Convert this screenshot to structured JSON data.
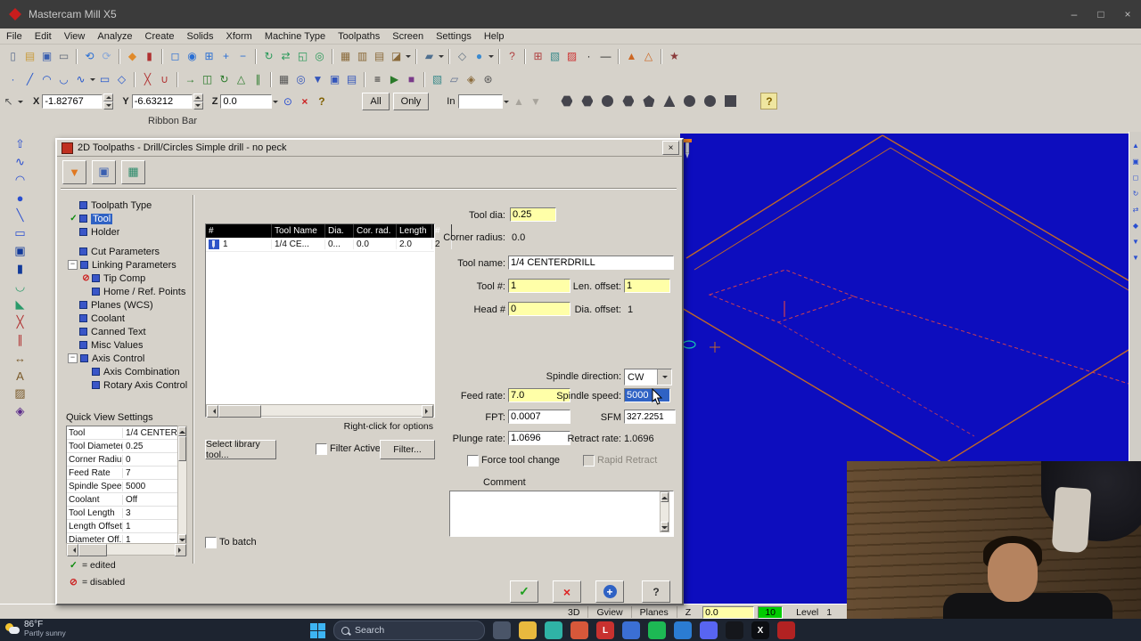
{
  "titlebar": {
    "title": "Mastercam Mill X5",
    "min": "–",
    "max": "□",
    "close": "×"
  },
  "menubar": [
    {
      "label": "File",
      "name": "menu-file"
    },
    {
      "label": "Edit",
      "name": "menu-edit"
    },
    {
      "label": "View",
      "name": "menu-view"
    },
    {
      "label": "Analyze",
      "name": "menu-analyze"
    },
    {
      "label": "Create",
      "name": "menu-create"
    },
    {
      "label": "Solids",
      "name": "menu-solids"
    },
    {
      "label": "Xform",
      "name": "menu-xform"
    },
    {
      "label": "Machine Type",
      "name": "menu-machine-type"
    },
    {
      "label": "Toolpaths",
      "name": "menu-toolpaths"
    },
    {
      "label": "Screen",
      "name": "menu-screen"
    },
    {
      "label": "Settings",
      "name": "menu-settings"
    },
    {
      "label": "Help",
      "name": "menu-help"
    }
  ],
  "toolbar1": [
    {
      "name": "new-file-icon",
      "g": "▯",
      "c": "#607090"
    },
    {
      "name": "open-folder-icon",
      "g": "▤",
      "c": "#c89a3a"
    },
    {
      "name": "save-icon",
      "g": "▣",
      "c": "#3a5fb0"
    },
    {
      "name": "print-icon",
      "g": "▭",
      "c": "#606878"
    },
    {
      "name": "toolbar-separator",
      "cls": "sepv"
    },
    {
      "name": "undo-icon",
      "g": "⟲",
      "c": "#2a6fd4"
    },
    {
      "name": "redo-icon",
      "g": "⟳",
      "c": "#8aa8d8"
    },
    {
      "name": "toolbar-separator",
      "cls": "sepv"
    },
    {
      "name": "xform-dynamic-icon",
      "g": "◆",
      "c": "#e08a2a"
    },
    {
      "name": "delete-entities-icon",
      "g": "▮",
      "c": "#b03030"
    },
    {
      "name": "toolbar-separator",
      "cls": "sepv"
    },
    {
      "name": "zoom-window-icon",
      "g": "◻",
      "c": "#2a6fd4"
    },
    {
      "name": "zoom-target-icon",
      "g": "◉",
      "c": "#2a6fd4"
    },
    {
      "name": "zoom-selected-icon",
      "g": "⊞",
      "c": "#2a6fd4"
    },
    {
      "name": "zoom-in-icon",
      "g": "+",
      "c": "#2a6fd4"
    },
    {
      "name": "zoom-out-icon",
      "g": "−",
      "c": "#2a6fd4"
    },
    {
      "name": "toolbar-separator",
      "cls": "sepv"
    },
    {
      "name": "dynamic-rotate-icon",
      "g": "↻",
      "c": "#2a9a5a"
    },
    {
      "name": "pan-icon",
      "g": "⇄",
      "c": "#2a9a5a"
    },
    {
      "name": "fit-screen-icon",
      "g": "◱",
      "c": "#2a9a5a"
    },
    {
      "name": "repaint-icon",
      "g": "◎",
      "c": "#2a9a5a"
    },
    {
      "name": "toolbar-separator",
      "cls": "sepv"
    },
    {
      "name": "gview-top-icon",
      "g": "▦",
      "c": "#8a6a3a"
    },
    {
      "name": "gview-front-icon",
      "g": "▥",
      "c": "#8a6a3a"
    },
    {
      "name": "gview-side-icon",
      "g": "▤",
      "c": "#8a6a3a"
    },
    {
      "name": "gview-isometric-icon",
      "g": "◪",
      "c": "#8a6a3a"
    },
    {
      "name": "dropdown-caret-icon",
      "cls": "caret"
    },
    {
      "name": "toolbar-separator",
      "cls": "sepv"
    },
    {
      "name": "planes-icon",
      "g": "▰",
      "c": "#507090"
    },
    {
      "name": "dropdown-caret-icon",
      "cls": "caret"
    },
    {
      "name": "toolbar-separator",
      "cls": "sepv"
    },
    {
      "name": "wireframe-display-icon",
      "g": "◇",
      "c": "#607080"
    },
    {
      "name": "shaded-display-icon",
      "g": "●",
      "c": "#3a8ad0"
    },
    {
      "name": "dropdown-caret-icon",
      "cls": "caret"
    },
    {
      "name": "toolbar-separator",
      "cls": "sepv"
    },
    {
      "name": "analyze-entity-icon",
      "g": "?",
      "c": "#b04040"
    },
    {
      "name": "toolbar-separator",
      "cls": "sepv"
    },
    {
      "name": "grid-settings-icon",
      "g": "⊞",
      "c": "#b04040"
    },
    {
      "name": "attributes-icon",
      "g": "▧",
      "c": "#3a8a8a"
    },
    {
      "name": "color-swatch-icon",
      "g": "▨",
      "c": "#cc3333"
    },
    {
      "name": "point-style-icon",
      "g": "·",
      "c": "#202020"
    },
    {
      "name": "line-style-icon",
      "g": "—",
      "c": "#202020"
    },
    {
      "name": "toolbar-separator",
      "cls": "sepv"
    },
    {
      "name": "wcs-icon",
      "g": "▲",
      "c": "#cc6622"
    },
    {
      "name": "gview-wcs-icon",
      "g": "△",
      "c": "#cc6622"
    },
    {
      "name": "toolbar-separator",
      "cls": "sepv"
    },
    {
      "name": "run-addin-icon",
      "g": "★",
      "c": "#8a3a3a"
    }
  ],
  "toolbar2": [
    {
      "name": "create-point-icon",
      "g": "·",
      "c": "#2255cc"
    },
    {
      "name": "create-line-icon",
      "g": "╱",
      "c": "#2255cc"
    },
    {
      "name": "create-arc-icon",
      "g": "◠",
      "c": "#2255cc"
    },
    {
      "name": "create-fillet-icon",
      "g": "◡",
      "c": "#2255cc"
    },
    {
      "name": "create-spline-icon",
      "g": "∿",
      "c": "#2255cc"
    },
    {
      "name": "dropdown-caret-icon",
      "cls": "caret"
    },
    {
      "name": "create-rectangle-icon",
      "g": "▭",
      "c": "#2255cc"
    },
    {
      "name": "create-polygon-icon",
      "g": "◇",
      "c": "#2255cc"
    },
    {
      "name": "toolbar-separator",
      "cls": "sepv"
    },
    {
      "name": "trim-break-icon",
      "g": "╳",
      "c": "#b03030"
    },
    {
      "name": "join-entities-icon",
      "g": "∪",
      "c": "#b03030"
    },
    {
      "name": "toolbar-separator",
      "cls": "sepv"
    },
    {
      "name": "xform-translate-icon",
      "g": "→",
      "c": "#2a7a2a"
    },
    {
      "name": "xform-mirror-icon",
      "g": "◫",
      "c": "#2a7a2a"
    },
    {
      "name": "xform-rotate-icon",
      "g": "↻",
      "c": "#2a7a2a"
    },
    {
      "name": "xform-scale-icon",
      "g": "△",
      "c": "#2a7a2a"
    },
    {
      "name": "xform-offset-icon",
      "g": "∥",
      "c": "#2a7a2a"
    },
    {
      "name": "toolbar-separator",
      "cls": "sepv"
    },
    {
      "name": "machine-group-icon",
      "g": "▦",
      "c": "#555555"
    },
    {
      "name": "toolpath-contour-icon",
      "g": "◎",
      "c": "#3355bb"
    },
    {
      "name": "toolpath-drill-icon",
      "g": "▼",
      "c": "#3355bb"
    },
    {
      "name": "toolpath-pocket-icon",
      "g": "▣",
      "c": "#3355bb"
    },
    {
      "name": "toolpath-face-icon",
      "g": "▤",
      "c": "#3355bb"
    },
    {
      "name": "toolbar-separator",
      "cls": "sepv"
    },
    {
      "name": "operations-manager-icon",
      "g": "≡",
      "c": "#202020"
    },
    {
      "name": "backplot-icon",
      "g": "▶",
      "c": "#2a7a2a"
    },
    {
      "name": "verify-icon",
      "g": "■",
      "c": "#7a3a8a"
    },
    {
      "name": "toolbar-separator",
      "cls": "sepv"
    },
    {
      "name": "levels-icon",
      "g": "▧",
      "c": "#3a8a8a"
    },
    {
      "name": "viewsheets-icon",
      "g": "▱",
      "c": "#607090"
    },
    {
      "name": "groups-icon",
      "g": "◈",
      "c": "#8a6a3a"
    },
    {
      "name": "settings-gear-icon",
      "g": "⊛",
      "c": "#555555"
    }
  ],
  "ribbon": {
    "x_label": "X",
    "x_value": "-1.82767",
    "y_label": "Y",
    "y_value": "-6.63212",
    "z_label": "Z",
    "z_value": "0.0",
    "all": "All",
    "only": "Only",
    "in_label": "In",
    "in_value": "",
    "help": "?",
    "shapes": [
      {
        "name": "autocursor-origin-icon",
        "cls": "hex"
      },
      {
        "name": "autocursor-arc-center-icon",
        "cls": "hex"
      },
      {
        "name": "autocursor-endpoint-icon",
        "cls": "cir"
      },
      {
        "name": "autocursor-intersection-icon",
        "cls": "hex"
      },
      {
        "name": "autocursor-midpoint-icon",
        "cls": "pent"
      },
      {
        "name": "autocursor-point-icon",
        "cls": "tri"
      },
      {
        "name": "autocursor-quadrant-icon",
        "cls": "cir"
      },
      {
        "name": "autocursor-along-icon",
        "cls": "cir"
      },
      {
        "name": "autocursor-nearest-icon",
        "cls": ""
      }
    ]
  },
  "ribbon_strip": {
    "label": "Ribbon Bar"
  },
  "left_toolbar": [
    {
      "name": "select-arrow-icon",
      "g": "⇧",
      "c": "#2a4fd0"
    },
    {
      "name": "spline-tool-icon",
      "g": "∿",
      "c": "#2a4fd0"
    },
    {
      "name": "arc-tool-icon",
      "g": "◠",
      "c": "#2a4fd0"
    },
    {
      "name": "circle-tool-icon",
      "g": "●",
      "c": "#2a4fd0"
    },
    {
      "name": "line-tool-icon",
      "g": "╲",
      "c": "#2a4fd0"
    },
    {
      "name": "rect-tool-icon",
      "g": "▭",
      "c": "#2a4fd0"
    },
    {
      "name": "solid-box-icon",
      "g": "▣",
      "c": "#123a9a"
    },
    {
      "name": "solid-cylinder-icon",
      "g": "▮",
      "c": "#123a9a"
    },
    {
      "name": "fillet-tool-icon",
      "g": "◡",
      "c": "#2a9a6a"
    },
    {
      "name": "chamfer-tool-icon",
      "g": "◣",
      "c": "#2a9a6a"
    },
    {
      "name": "trim-tool-icon",
      "g": "╳",
      "c": "#b03030"
    },
    {
      "name": "offset-tool-icon",
      "g": "∥",
      "c": "#b03030"
    },
    {
      "name": "dimension-tool-icon",
      "g": "↔",
      "c": "#7a5a2a"
    },
    {
      "name": "note-tool-icon",
      "g": "A",
      "c": "#7a5a2a"
    },
    {
      "name": "hatch-tool-icon",
      "g": "▨",
      "c": "#7a5a2a"
    },
    {
      "name": "xform-tool-icon",
      "g": "◈",
      "c": "#5a2a8a"
    }
  ],
  "right_toolbar": [
    {
      "name": "scroll-up-icon",
      "g": "▲"
    },
    {
      "name": "fit-view-shortcut-icon",
      "g": "▣"
    },
    {
      "name": "zoom-shortcut-icon",
      "g": "◻"
    },
    {
      "name": "rotate-shortcut-icon",
      "g": "↻"
    },
    {
      "name": "pan-shortcut-icon",
      "g": "⇄"
    },
    {
      "name": "view-shortcut-icon",
      "g": "◆"
    },
    {
      "name": "scroll-down-icon",
      "g": "▼"
    },
    {
      "name": "scroll-down2-icon",
      "g": "▼"
    }
  ],
  "dialog": {
    "title": "2D Toolpaths - Drill/Circles Simple drill - no peck",
    "close": "×",
    "toolbar_icons": [
      {
        "name": "tool-manager-icon",
        "g": "▼",
        "c": "#e07820"
      },
      {
        "name": "save-parameters-icon",
        "g": "▣",
        "c": "#3a5fb0"
      },
      {
        "name": "tool-display-icon",
        "g": "▦",
        "c": "#2a8a6a"
      }
    ],
    "tree": [
      {
        "label": "Toolpath Type",
        "name": "tree-item-toolpath-type"
      },
      {
        "label": "Tool",
        "mark": "✓",
        "cls": "sel mk-green",
        "name": "tree-item-tool"
      },
      {
        "label": "Holder",
        "name": "tree-item-holder"
      },
      {
        "label": "Cut Parameters",
        "cls": "gaptop",
        "name": "tree-item-cut-parameters"
      },
      {
        "label": "Linking Parameters",
        "mark": "−",
        "cls": "mk-exp",
        "name": "tree-item-linking-parameters"
      },
      {
        "label": "Tip Comp",
        "mark": "⊘",
        "cls": "lvl1 mk-red",
        "name": "tree-item-tip-comp"
      },
      {
        "label": "Home / Ref. Points",
        "cls": "lvl1",
        "name": "tree-item-home-ref-points"
      },
      {
        "label": "Planes (WCS)",
        "name": "tree-item-planes-wcs"
      },
      {
        "label": "Coolant",
        "name": "tree-item-coolant"
      },
      {
        "label": "Canned Text",
        "name": "tree-item-canned-text"
      },
      {
        "label": "Misc Values",
        "name": "tree-item-misc-values"
      },
      {
        "label": "Axis Control",
        "mark": "−",
        "cls": "mk-exp",
        "name": "tree-item-axis-control"
      },
      {
        "label": "Axis Combination",
        "cls": "lvl1",
        "name": "tree-item-axis-combination"
      },
      {
        "label": "Rotary Axis Control",
        "cls": "lvl1",
        "name": "tree-item-rotary-axis-control"
      }
    ],
    "quick_view": {
      "title": "Quick View Settings",
      "rows": [
        {
          "k": "Tool",
          "v": "1/4 CENTER.",
          "name": "qv-row-tool"
        },
        {
          "k": "Tool Diameter",
          "v": "0.25",
          "name": "qv-row-tool-diameter"
        },
        {
          "k": "Corner Radius",
          "v": "0",
          "name": "qv-row-corner-radius"
        },
        {
          "k": "Feed Rate",
          "v": "7",
          "name": "qv-row-feed-rate"
        },
        {
          "k": "Spindle Speed",
          "v": "5000",
          "name": "qv-row-spindle-speed"
        },
        {
          "k": "Coolant",
          "v": "Off",
          "name": "qv-row-coolant"
        },
        {
          "k": "Tool Length",
          "v": "3",
          "name": "qv-row-tool-length"
        },
        {
          "k": "Length Offset",
          "v": "1",
          "name": "qv-row-length-offset"
        },
        {
          "k": "Diameter Off...",
          "v": "1",
          "name": "qv-row-diameter-offset"
        }
      ]
    },
    "legend": {
      "edited_mark": "✓",
      "edited": "= edited",
      "disabled_mark": "⊘",
      "disabled": "= disabled"
    },
    "grid": {
      "headers": [
        {
          "label": "#",
          "cls": "c1",
          "name": "grid-col-number"
        },
        {
          "label": "Tool Name",
          "cls": "c2",
          "name": "grid-col-tool-name"
        },
        {
          "label": "Dia.",
          "cls": "c3",
          "name": "grid-col-dia"
        },
        {
          "label": "Cor. rad.",
          "cls": "c4",
          "name": "grid-col-cor-rad"
        },
        {
          "label": "Length",
          "cls": "c5",
          "name": "grid-col-length"
        },
        {
          "label": "#",
          "cls": "c6",
          "name": "grid-col-flutes"
        }
      ],
      "row": {
        "num": "1",
        "name": "1/4 CE...",
        "dia": "0...",
        "cor": "0.0",
        "len": "2.0",
        "fl": "2"
      },
      "hint": "Right-click for options"
    },
    "buttons": {
      "select_library": "Select library tool...",
      "filter_active": "Filter Active",
      "filter": "Filter...",
      "force_tool_change": "Force tool change",
      "rapid_retract": "Rapid Retract",
      "to_batch": "To batch",
      "ok_glyph": "✓",
      "cancel_glyph": "×",
      "add_glyph": "+",
      "help_glyph": "?"
    },
    "fields": {
      "tool_dia_label": "Tool dia:",
      "tool_dia": "0.25",
      "corner_radius_label": "Corner radius:",
      "corner_radius": "0.0",
      "tool_name_label": "Tool name:",
      "tool_name": "1/4 CENTERDRILL",
      "tool_num_label": "Tool #:",
      "tool_num": "1",
      "len_offset_label": "Len. offset:",
      "len_offset": "1",
      "head_num_label": "Head #",
      "head_num": "0",
      "dia_offset_label": "Dia. offset:",
      "dia_offset": "1",
      "spindle_dir_label": "Spindle direction:",
      "spindle_dir": "CW",
      "feed_rate_label": "Feed rate:",
      "feed_rate": "7.0",
      "spindle_speed_label": "Spindle speed:",
      "spindle_speed": "5000",
      "fpt_label": "FPT:",
      "fpt": "0.0007",
      "sfm_label": "SFM",
      "sfm": "327.2251",
      "plunge_label": "Plunge rate:",
      "plunge": "1.0696",
      "retract_label": "Retract rate:",
      "retract": "1.0696",
      "comment_label": "Comment"
    }
  },
  "statusbar": {
    "s3d": "3D",
    "gview": "Gview",
    "planes": "Planes",
    "z": "Z",
    "z_value": "0.0",
    "color_value": "10",
    "level": "Level",
    "level_value": "1"
  },
  "taskbar": {
    "temp": "86°F",
    "cond": "Partly sunny",
    "search_placeholder": "Search",
    "apps": [
      {
        "name": "taskview-icon",
        "c": "#4a5568"
      },
      {
        "name": "file-explorer-icon",
        "c": "#e8b93e"
      },
      {
        "name": "edge-icon",
        "c": "#2fb3a6"
      },
      {
        "name": "chrome-icon",
        "c": "#d7583a"
      },
      {
        "name": "l-app-icon",
        "c": "#c8312f",
        "g": "L"
      },
      {
        "name": "photos-icon",
        "c": "#3b6fd4"
      },
      {
        "name": "spotify-icon",
        "c": "#1db954"
      },
      {
        "name": "mail-icon",
        "c": "#2b7cd3"
      },
      {
        "name": "discord-icon",
        "c": "#5865f2"
      },
      {
        "name": "obs-icon",
        "c": "#15171c"
      },
      {
        "name": "x-app-icon",
        "c": "#0c0e12",
        "g": "X"
      },
      {
        "name": "recorder-icon",
        "c": "#b22222"
      }
    ]
  }
}
